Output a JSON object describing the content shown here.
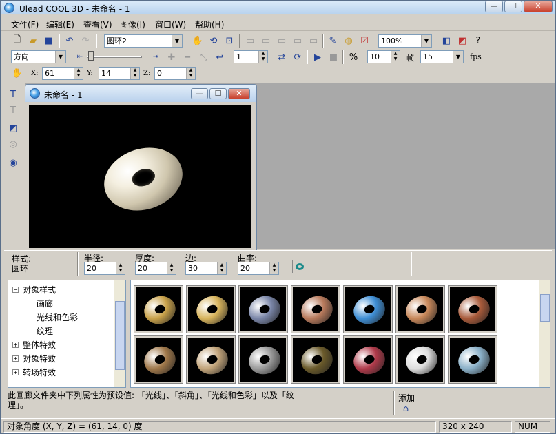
{
  "app": {
    "title": "Ulead COOL 3D - 未命名 - 1"
  },
  "window_controls": {
    "minimize": "—",
    "maximize": "☐",
    "close": "✕"
  },
  "menu": [
    "文件(F)",
    "编辑(E)",
    "查看(V)",
    "图像(I)",
    "窗口(W)",
    "帮助(H)"
  ],
  "toolbar1": {
    "object_combo": "圆环2",
    "zoom_combo": "100%"
  },
  "toolbar2": {
    "mode_combo": "方向",
    "frame_value": "1",
    "speed_value": "10",
    "frame_label": "帧",
    "fps_value": "15",
    "fps_label": "fps"
  },
  "toolbar3": {
    "x_label": "X:",
    "x_value": "61",
    "y_label": "Y:",
    "y_value": "14",
    "z_label": "Z:",
    "z_value": "0"
  },
  "child": {
    "title": "未命名 - 1"
  },
  "props": {
    "style_label": "样式:",
    "style_value": "圆环",
    "radius_label": "半径:",
    "radius_value": "20",
    "thickness_label": "厚度:",
    "thickness_value": "20",
    "sides_label": "边:",
    "sides_value": "30",
    "curvature_label": "曲率:",
    "curvature_value": "20"
  },
  "tree": [
    {
      "label": "对象样式",
      "expander": "−"
    },
    {
      "label": "画廊"
    },
    {
      "label": "光线和色彩"
    },
    {
      "label": "纹理"
    },
    {
      "label": "整体特效",
      "expander": "+"
    },
    {
      "label": "对象特效",
      "expander": "+"
    },
    {
      "label": "转场特效",
      "expander": "+"
    }
  ],
  "thumbnails": [
    {
      "color": "#c9a24a"
    },
    {
      "color": "#d8b45c"
    },
    {
      "color": "#7a86a8"
    },
    {
      "color": "#b87a5c"
    },
    {
      "color": "#3f8fd6"
    },
    {
      "color": "#c8885a"
    },
    {
      "color": "#a85a3a"
    },
    {
      "color": "#a0784a"
    },
    {
      "color": "#c2a47a"
    },
    {
      "color": "#9a9a9a"
    },
    {
      "color": "#6a5a2a"
    },
    {
      "color": "#b03a4a"
    },
    {
      "color": "#dddddd"
    },
    {
      "color": "#8ab0c8"
    }
  ],
  "description": {
    "line1": "此画廊文件夹中下列属性为预设值: 「光线」、「斜角」、「光线和色彩」以及「纹",
    "line2": "理」。",
    "add_label": "添加"
  },
  "status": {
    "angle": "对象角度 (X, Y, Z) = (61, 14, 0) 度",
    "size": "320 x 240",
    "num": "NUM"
  }
}
